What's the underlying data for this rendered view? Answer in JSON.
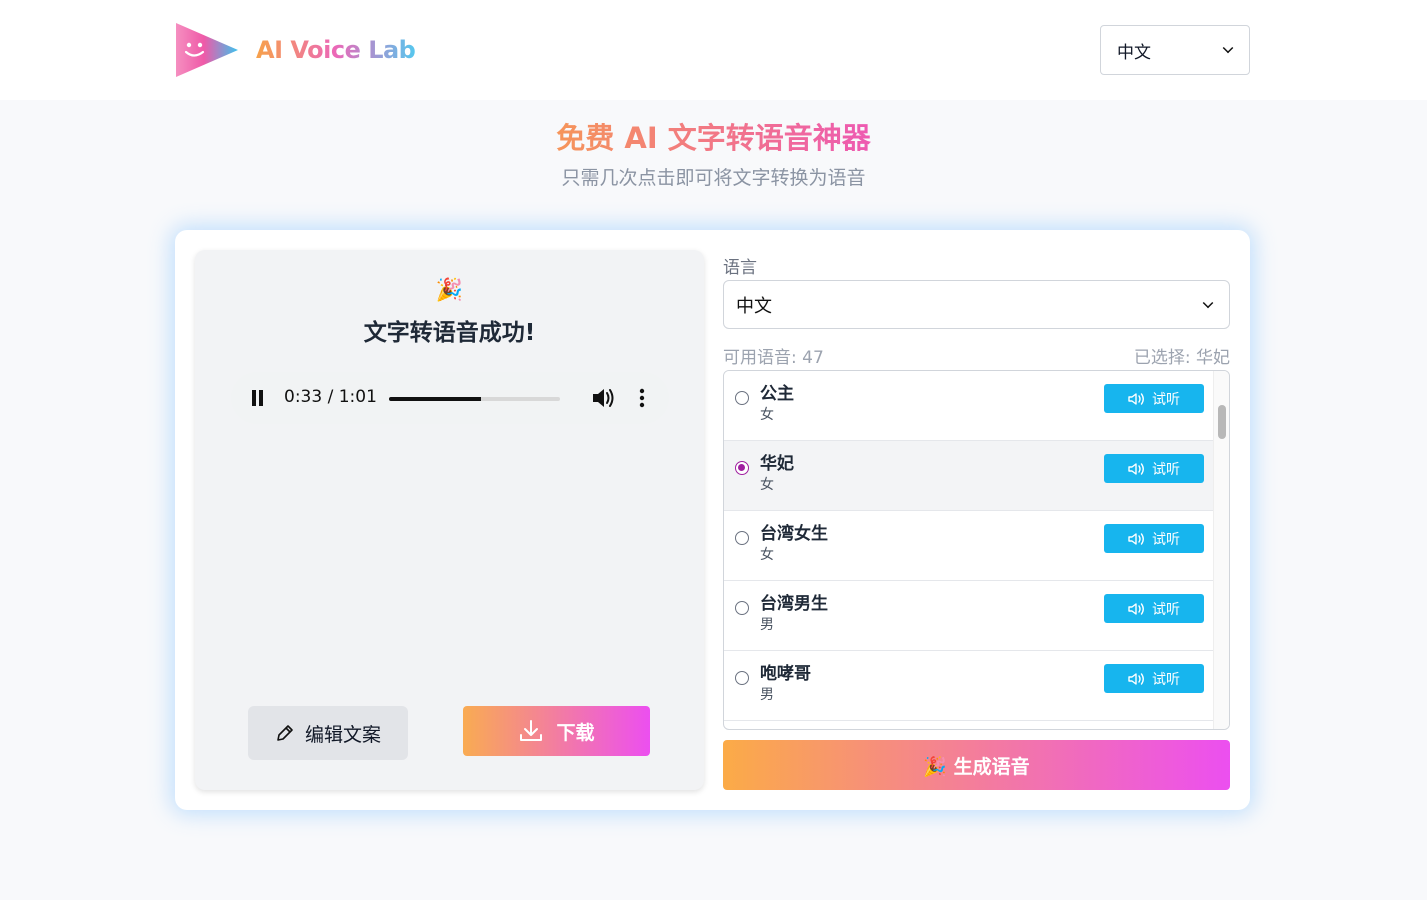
{
  "header": {
    "brand": "AI Voice Lab",
    "language": "中文"
  },
  "hero": {
    "title": "免费 AI 文字转语音神器",
    "subtitle": "只需几次点击即可将文字转换为语音"
  },
  "result": {
    "emoji": "🎉",
    "title": "文字转语音成功!",
    "audio": {
      "current": "0:33",
      "separator": "/",
      "duration": "1:01",
      "progress": 0.54
    },
    "edit_label": "编辑文案",
    "download_label": "下载"
  },
  "settings": {
    "language_label": "语言",
    "language_value": "中文",
    "available": "可用语音: 47",
    "selected": "已选择: 华妃",
    "try_label": "试听",
    "voices": [
      {
        "name": "公主",
        "gender": "女",
        "selected": false
      },
      {
        "name": "华妃",
        "gender": "女",
        "selected": true
      },
      {
        "name": "台湾女生",
        "gender": "女",
        "selected": false
      },
      {
        "name": "台湾男生",
        "gender": "男",
        "selected": false
      },
      {
        "name": "咆哮哥",
        "gender": "男",
        "selected": false
      }
    ],
    "generate_label": "🎉 生成语音"
  },
  "colors": {
    "accent_blue": "#17b5ee",
    "gradient_start": "#f9ab52",
    "gradient_end": "#ec4ff0",
    "radio_selected": "#a01fa0"
  },
  "icons": [
    "logo-play-icon",
    "chevron-down-icon",
    "pause-icon",
    "volume-icon",
    "more-vert-icon",
    "pencil-icon",
    "download-icon",
    "speaker-icon"
  ]
}
